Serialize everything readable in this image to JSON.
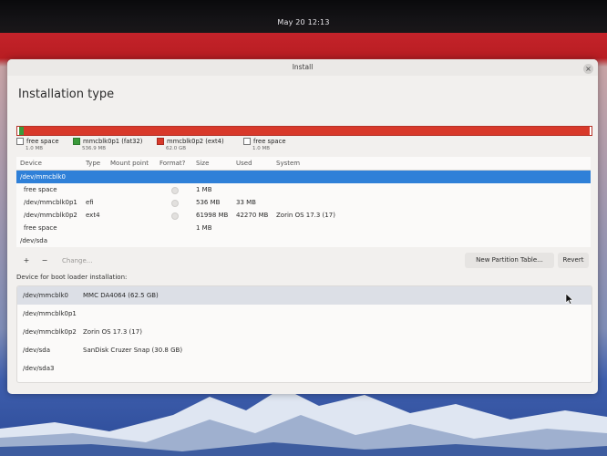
{
  "topbar": {
    "clock": "May 20  12:13"
  },
  "dialog": {
    "title": "Install",
    "close_icon": "×",
    "heading": "Installation type"
  },
  "colors": {
    "wallpaper_red": "#c4232a",
    "free_space": "#ffffff",
    "fat32": "#3a9a3a",
    "ext4": "#d8392a",
    "selection": "#2f80d8"
  },
  "legend": [
    {
      "label": "free space",
      "size": "1.0 MB",
      "swatch": "white"
    },
    {
      "label": "mmcblk0p1 (fat32)",
      "size": "536.9 MB",
      "swatch": "green"
    },
    {
      "label": "mmcblk0p2 (ext4)",
      "size": "62.0 GB",
      "swatch": "red"
    },
    {
      "label": "free space",
      "size": "1.0 MB",
      "swatch": "white"
    }
  ],
  "table": {
    "headers": [
      "Device",
      "Type",
      "Mount point",
      "Format?",
      "Size",
      "Used",
      "System"
    ],
    "rows": [
      {
        "device": "/dev/mmcblk0",
        "type": "",
        "mount": "",
        "format": false,
        "size": "",
        "used": "",
        "system": "",
        "selected": true,
        "indent": false
      },
      {
        "device": "free space",
        "type": "",
        "mount": "",
        "format": true,
        "size": "1 MB",
        "used": "",
        "system": "",
        "selected": false,
        "indent": true
      },
      {
        "device": "/dev/mmcblk0p1",
        "type": "efi",
        "mount": "",
        "format": true,
        "size": "536 MB",
        "used": "33 MB",
        "system": "",
        "selected": false,
        "indent": true
      },
      {
        "device": "/dev/mmcblk0p2",
        "type": "ext4",
        "mount": "",
        "format": true,
        "size": "61998 MB",
        "used": "42270 MB",
        "system": "Zorin OS 17.3 (17)",
        "selected": false,
        "indent": true
      },
      {
        "device": "free space",
        "type": "",
        "mount": "",
        "format": false,
        "size": "1 MB",
        "used": "",
        "system": "",
        "selected": false,
        "indent": true
      },
      {
        "device": "/dev/sda",
        "type": "",
        "mount": "",
        "format": false,
        "size": "",
        "used": "",
        "system": "",
        "selected": false,
        "indent": false
      }
    ]
  },
  "toolbar": {
    "add": "+",
    "remove": "−",
    "change": "Change...",
    "new_partition_table": "New Partition Table...",
    "revert": "Revert"
  },
  "boot": {
    "label": "Device for boot loader installation:",
    "items": [
      {
        "device": "/dev/mmcblk0",
        "desc": "MMC DA4064 (62.5 GB)"
      },
      {
        "device": "/dev/mmcblk0p1",
        "desc": ""
      },
      {
        "device": "/dev/mmcblk0p2",
        "desc": "Zorin OS 17.3 (17)"
      },
      {
        "device": "/dev/sda",
        "desc": "SanDisk Cruzer Snap (30.8 GB)"
      },
      {
        "device": "/dev/sda3",
        "desc": ""
      }
    ]
  }
}
